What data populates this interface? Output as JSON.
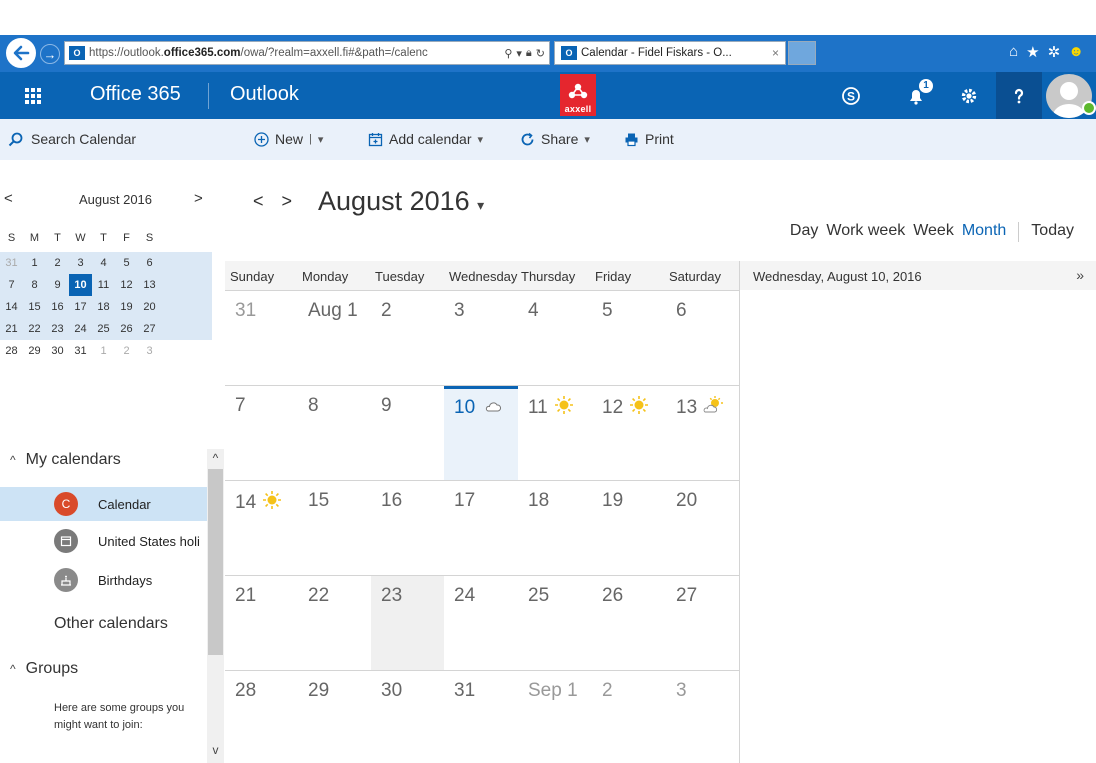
{
  "browser": {
    "address_prefix": "https://outlook.",
    "address_host": "office365.com",
    "address_path": "/owa/?realm=axxell.fi#&path=/calenc",
    "tab_title": "Calendar - Fidel Fiskars - O...",
    "tab_close": "×",
    "win_min": "–",
    "win_max": "☐",
    "win_close": "×",
    "icon_letters": "O"
  },
  "suite": {
    "brand": "Office 365",
    "app": "Outlook",
    "logo_text": "axxell",
    "notification_count": "1",
    "accent": "#0a64b4",
    "logo_color": "#e5262e"
  },
  "toolbar": {
    "search_label": "Search Calendar",
    "new_label": "New",
    "new_split": "|",
    "add_calendar_label": "Add calendar",
    "share_label": "Share",
    "print_label": "Print"
  },
  "mini_calendar": {
    "title": "August 2016",
    "prev": "<",
    "next": ">",
    "dow": [
      "S",
      "M",
      "T",
      "W",
      "T",
      "F",
      "S"
    ],
    "weeks": [
      [
        "31",
        "1",
        "2",
        "3",
        "4",
        "5",
        "6"
      ],
      [
        "7",
        "8",
        "9",
        "10",
        "11",
        "12",
        "13"
      ],
      [
        "14",
        "15",
        "16",
        "17",
        "18",
        "19",
        "20"
      ],
      [
        "21",
        "22",
        "23",
        "24",
        "25",
        "26",
        "27"
      ],
      [
        "28",
        "29",
        "30",
        "31",
        "1",
        "2",
        "3"
      ]
    ]
  },
  "sidebar": {
    "my_calendars": "My calendars",
    "calendars": [
      {
        "label": "Calendar",
        "initial": "C",
        "color": "#d94a2a"
      },
      {
        "label": "United States holi",
        "initial": "",
        "color": "#7a7a7a"
      },
      {
        "label": "Birthdays",
        "initial": "",
        "color": "#8a8a8a"
      }
    ],
    "other_calendars": "Other calendars",
    "groups": "Groups",
    "groups_hint": "Here are some groups you might want to join:"
  },
  "main": {
    "title": "August 2016",
    "prev": "<",
    "next": ">",
    "views": [
      "Day",
      "Work week",
      "Week",
      "Month",
      "Today"
    ],
    "active_view": "Month",
    "weekdays": [
      "Sunday",
      "Monday",
      "Tuesday",
      "Wednesday",
      "Thursday",
      "Friday",
      "Saturday"
    ],
    "agenda_date": "Wednesday, August 10, 2016",
    "agenda_expand": "»",
    "weeks": [
      [
        "31",
        "Aug 1",
        "2",
        "3",
        "4",
        "5",
        "6"
      ],
      [
        "7",
        "8",
        "9",
        "10",
        "11",
        "12",
        "13"
      ],
      [
        "14",
        "15",
        "16",
        "17",
        "18",
        "19",
        "20"
      ],
      [
        "21",
        "22",
        "23",
        "24",
        "25",
        "26",
        "27"
      ],
      [
        "28",
        "29",
        "30",
        "31",
        "Sep 1",
        "2",
        "3"
      ]
    ]
  }
}
